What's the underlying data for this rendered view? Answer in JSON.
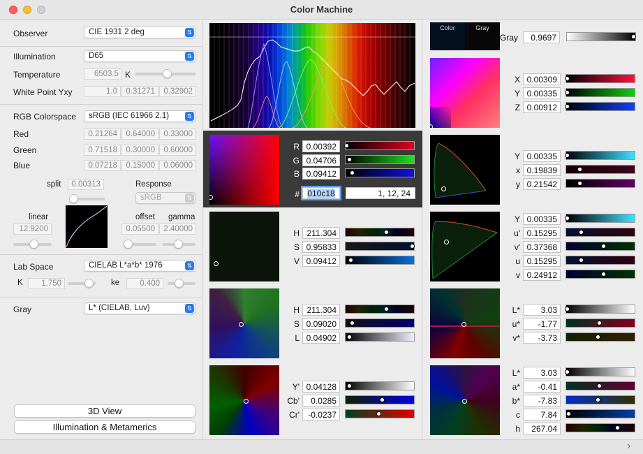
{
  "title": "Color Machine",
  "left": {
    "observer_label": "Observer",
    "observer_value": "CIE 1931 2 deg",
    "illumination_label": "Illumination",
    "illumination_value": "D65",
    "temperature_label": "Temperature",
    "temperature_value": "6503.5",
    "temperature_unit": "K",
    "white_point_label": "White Point Yxy",
    "white_point": [
      "1.0",
      "0.31271",
      "0.32902"
    ],
    "colorspace_label": "RGB Colorspace",
    "colorspace_value": "sRGB (IEC 61966 2.1)",
    "primaries": [
      {
        "label": "Red",
        "values": [
          "0.21264",
          "0.64000",
          "0.33000"
        ]
      },
      {
        "label": "Green",
        "values": [
          "0.71518",
          "0.30000",
          "0.60000"
        ]
      },
      {
        "label": "Blue",
        "values": [
          "0.07218",
          "0.15000",
          "0.06000"
        ]
      }
    ],
    "split_label": "split",
    "split_value": "0.00313",
    "response_label": "Response",
    "response_value": "sRGB",
    "linear_label": "linear",
    "linear_value": "12.9200",
    "offset_label": "offset",
    "offset_value": "0.05500",
    "gamma_label": "gamma",
    "gamma_value": "2.40000",
    "lab_space_label": "Lab Space",
    "lab_space_value": "CIELAB L*a*b* 1976",
    "k_label": "K",
    "k_value": "1.750",
    "ke_label": "ke",
    "ke_value": "0.400",
    "gray_label": "Gray",
    "gray_value": "L* (CIELAB, Luv)",
    "view3d_label": "3D View",
    "illum_meta_label": "Illumination & Metamerics"
  },
  "mid": {
    "rgb": [
      {
        "label": "R",
        "value": "0.00392"
      },
      {
        "label": "G",
        "value": "0.04706"
      },
      {
        "label": "B",
        "value": "0.09412"
      }
    ],
    "hex_label": "#",
    "hex_value": "010c18",
    "rgb255": "1, 12, 24",
    "hsv": [
      {
        "label": "H",
        "value": "211.304"
      },
      {
        "label": "S",
        "value": "0.95833"
      },
      {
        "label": "V",
        "value": "0.09412"
      }
    ],
    "hsl": [
      {
        "label": "H",
        "value": "211.304"
      },
      {
        "label": "S",
        "value": "0.09020"
      },
      {
        "label": "L",
        "value": "0.04902"
      }
    ],
    "ycbcr": [
      {
        "label": "Y'",
        "value": "0.04128"
      },
      {
        "label": "Cb'",
        "value": "0.0285"
      },
      {
        "label": "Cr'",
        "value": "-0.0237"
      }
    ]
  },
  "right": {
    "color_label": "Color",
    "gray_swatch_label": "Gray",
    "gray_label": "Gray",
    "gray_value": "0.9697",
    "xyz": [
      {
        "label": "X",
        "value": "0.00309"
      },
      {
        "label": "Y",
        "value": "0.00335"
      },
      {
        "label": "Z",
        "value": "0.00912"
      }
    ],
    "yxy": [
      {
        "label": "Y",
        "value": "0.00335"
      },
      {
        "label": "x",
        "value": "0.19839"
      },
      {
        "label": "y",
        "value": "0.21542"
      }
    ],
    "yuv": [
      {
        "label": "Y",
        "value": "0.00335"
      },
      {
        "label": "u'",
        "value": "0.15295"
      },
      {
        "label": "v'",
        "value": "0.37368"
      },
      {
        "label": "u",
        "value": "0.15295"
      },
      {
        "label": "v",
        "value": "0.24912"
      }
    ],
    "luv": [
      {
        "label": "L*",
        "value": "3.03"
      },
      {
        "label": "u*",
        "value": "-1.77"
      },
      {
        "label": "v*",
        "value": "-3.73"
      }
    ],
    "lab": [
      {
        "label": "L*",
        "value": "3.03"
      },
      {
        "label": "a*",
        "value": "-0.41"
      },
      {
        "label": "b*",
        "value": "-7.83"
      },
      {
        "label": "c",
        "value": "7.84"
      },
      {
        "label": "h",
        "value": "267.04"
      }
    ]
  },
  "colors": {
    "accent": "#2a7bf2",
    "selected_color": "#010c18"
  }
}
